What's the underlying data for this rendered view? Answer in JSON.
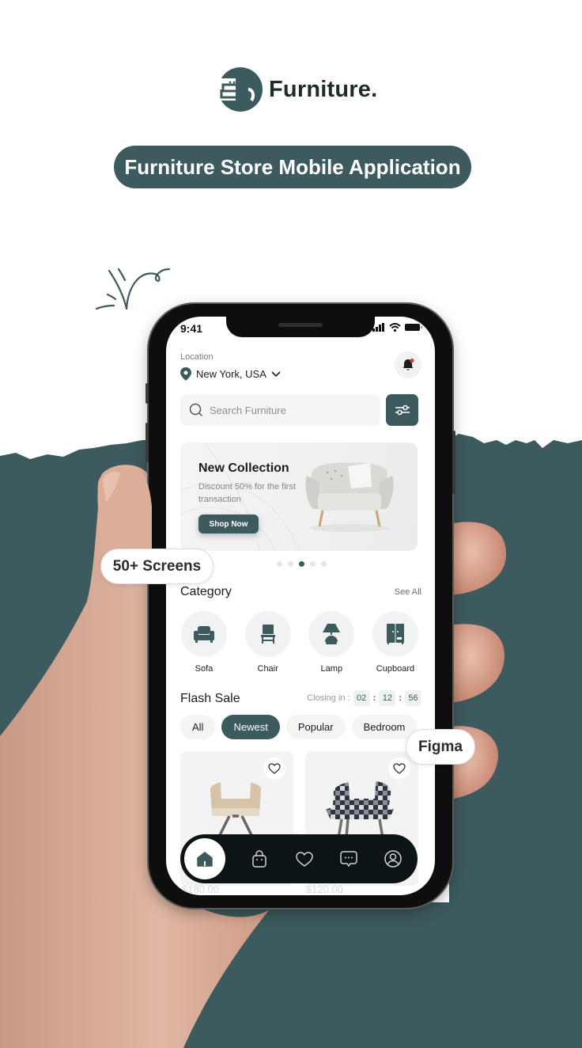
{
  "brand": {
    "name": "Furniture.",
    "logo_icon": "armchair-logo-icon"
  },
  "tagline": "Furniture Store Mobile Application",
  "colors": {
    "accent": "#3d5a5e",
    "dark": "#0d1416",
    "notification": "#e5383b",
    "skin": "#d9a48c"
  },
  "badges": {
    "screens": "50+ Screens",
    "tool": "Figma"
  },
  "app": {
    "status_bar": {
      "time": "9:41",
      "icons": [
        "signal-icon",
        "wifi-icon",
        "battery-icon"
      ]
    },
    "location": {
      "label": "Location",
      "value": "New York, USA"
    },
    "search": {
      "placeholder": "Search Furniture"
    },
    "banner": {
      "title": "New Collection",
      "subtitle": "Discount 50% for the first transaction",
      "button": "Shop Now",
      "slides": 5,
      "active_slide": 3
    },
    "category": {
      "title": "Category",
      "see_all": "See All",
      "items": [
        {
          "label": "Sofa",
          "icon": "sofa-icon"
        },
        {
          "label": "Chair",
          "icon": "chair-icon"
        },
        {
          "label": "Lamp",
          "icon": "lamp-icon"
        },
        {
          "label": "Cupboard",
          "icon": "cupboard-icon"
        }
      ]
    },
    "flash_sale": {
      "title": "Flash Sale",
      "closing_label": "Closing in :",
      "hours": "02",
      "minutes": "12",
      "seconds": "56",
      "filters": [
        {
          "label": "All",
          "active": false
        },
        {
          "label": "Newest",
          "active": true
        },
        {
          "label": "Popular",
          "active": false
        },
        {
          "label": "Bedroom",
          "active": false
        }
      ],
      "products": [
        {
          "price": "$180.00"
        },
        {
          "price": "$120.00"
        }
      ]
    },
    "nav": [
      "home-icon",
      "bag-icon",
      "heart-icon",
      "chat-icon",
      "profile-icon"
    ]
  }
}
